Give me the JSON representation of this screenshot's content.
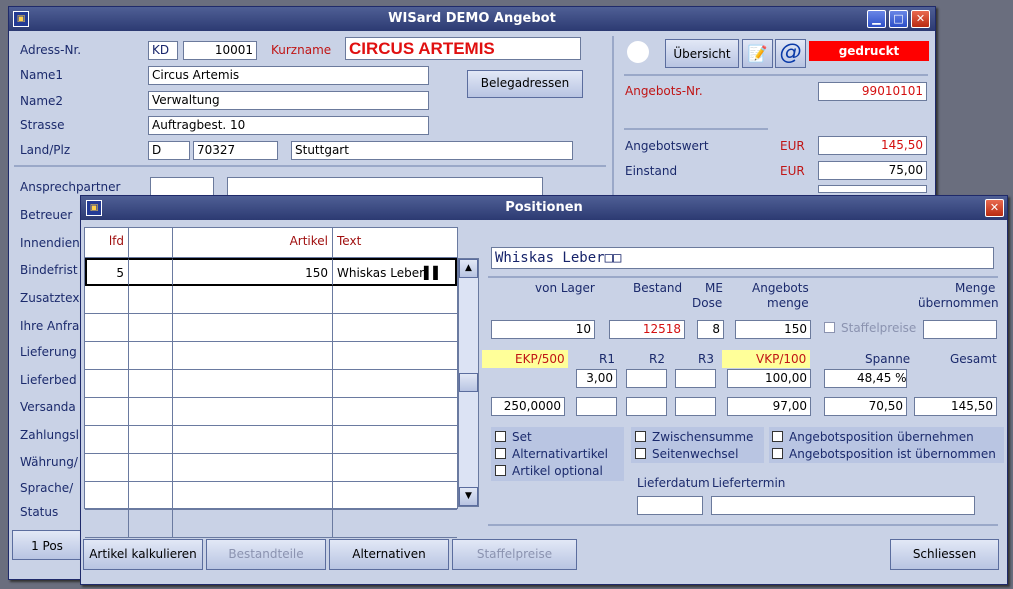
{
  "main_window": {
    "title": "WISard DEMO Angebot",
    "labels": {
      "adress_nr": "Adress-Nr.",
      "kurzname": "Kurzname",
      "name1": "Name1",
      "name2": "Name2",
      "strasse": "Strasse",
      "land_plz": "Land/Plz"
    },
    "values": {
      "adress_type": "KD",
      "adress_nr": "10001",
      "kurzname": "CIRCUS ARTEMIS",
      "name1": "Circus Artemis",
      "name2": "Verwaltung",
      "strasse": "Auftragbest. 10",
      "land": "D",
      "plz": "70327",
      "ort": "Stuttgart"
    },
    "left_labels": [
      "Ansprechpartner",
      "Betreuer",
      "Innendien",
      "Bindefrist",
      "Zusatztex",
      "Ihre Anfra",
      "Lieferung",
      "Lieferbed",
      "Versanda",
      "Zahlungsl",
      "Währung/",
      "Sprache/",
      "Status"
    ],
    "belegadressen_button": "Belegadressen",
    "uebersicht_button": "Übersicht",
    "at_button": "@",
    "status_badge": "gedruckt",
    "angebots_nr_label": "Angebots-Nr.",
    "angebots_nr": "99010101",
    "angebotswert_label": "Angebotswert",
    "einstand_label": "Einstand",
    "currency": "EUR",
    "angebotswert": "145,50",
    "einstand": "75,00",
    "bottom_tab": "1 Pos"
  },
  "positions_window": {
    "title": "Positionen",
    "grid_headers": {
      "lfd": "lfd",
      "col2": "",
      "artikel": "Artikel",
      "text": "Text"
    },
    "rows": [
      {
        "lfd": "5",
        "col2": "",
        "artikel": "150",
        "text": "Whiskas Leber▌▌"
      }
    ],
    "article_text": "Whiskas Leber□□",
    "labels": {
      "von_lager": "von Lager",
      "bestand": "Bestand",
      "me": "ME",
      "dose": "Dose",
      "angebots": "Angebots",
      "menge": "menge",
      "menge2": "Menge",
      "uebernommen": "übernommen",
      "ekp": "EKP/500",
      "r1": "R1",
      "r2": "R2",
      "r3": "R3",
      "vkp": "VKP/100",
      "spanne": "Spanne",
      "gesamt": "Gesamt",
      "staffelpreise_cb": "Staffelpreise"
    },
    "values": {
      "von_lager": "10",
      "bestand": "12518",
      "me": "8",
      "angebotsmenge": "150",
      "menge_uebernommen": "",
      "r1": "3,00",
      "r2": "",
      "r3": "",
      "vkp": "100,00",
      "spanne_pct": "48,45 %",
      "ekp": "250,0000",
      "r1b": "",
      "r2b": "",
      "r3b": "",
      "vkp_net": "97,00",
      "spanne": "70,50",
      "gesamt": "145,50"
    },
    "checkboxes": {
      "set": "Set",
      "alternativ": "Alternativartikel",
      "optional": "Artikel optional",
      "zwischensumme": "Zwischensumme",
      "seitenwechsel": "Seitenwechsel",
      "uebernehmen": "Angebotsposition übernehmen",
      "ist_uebernommen": "Angebotsposition ist übernommen"
    },
    "lieferdatum_label": "Lieferdatum",
    "liefertermin_label": "Liefertermin",
    "buttons": {
      "kalkulieren": "Artikel kalkulieren",
      "bestandteile": "Bestandteile",
      "alternativen": "Alternativen",
      "staffelpreise": "Staffelpreise",
      "schliessen": "Schliessen"
    }
  }
}
